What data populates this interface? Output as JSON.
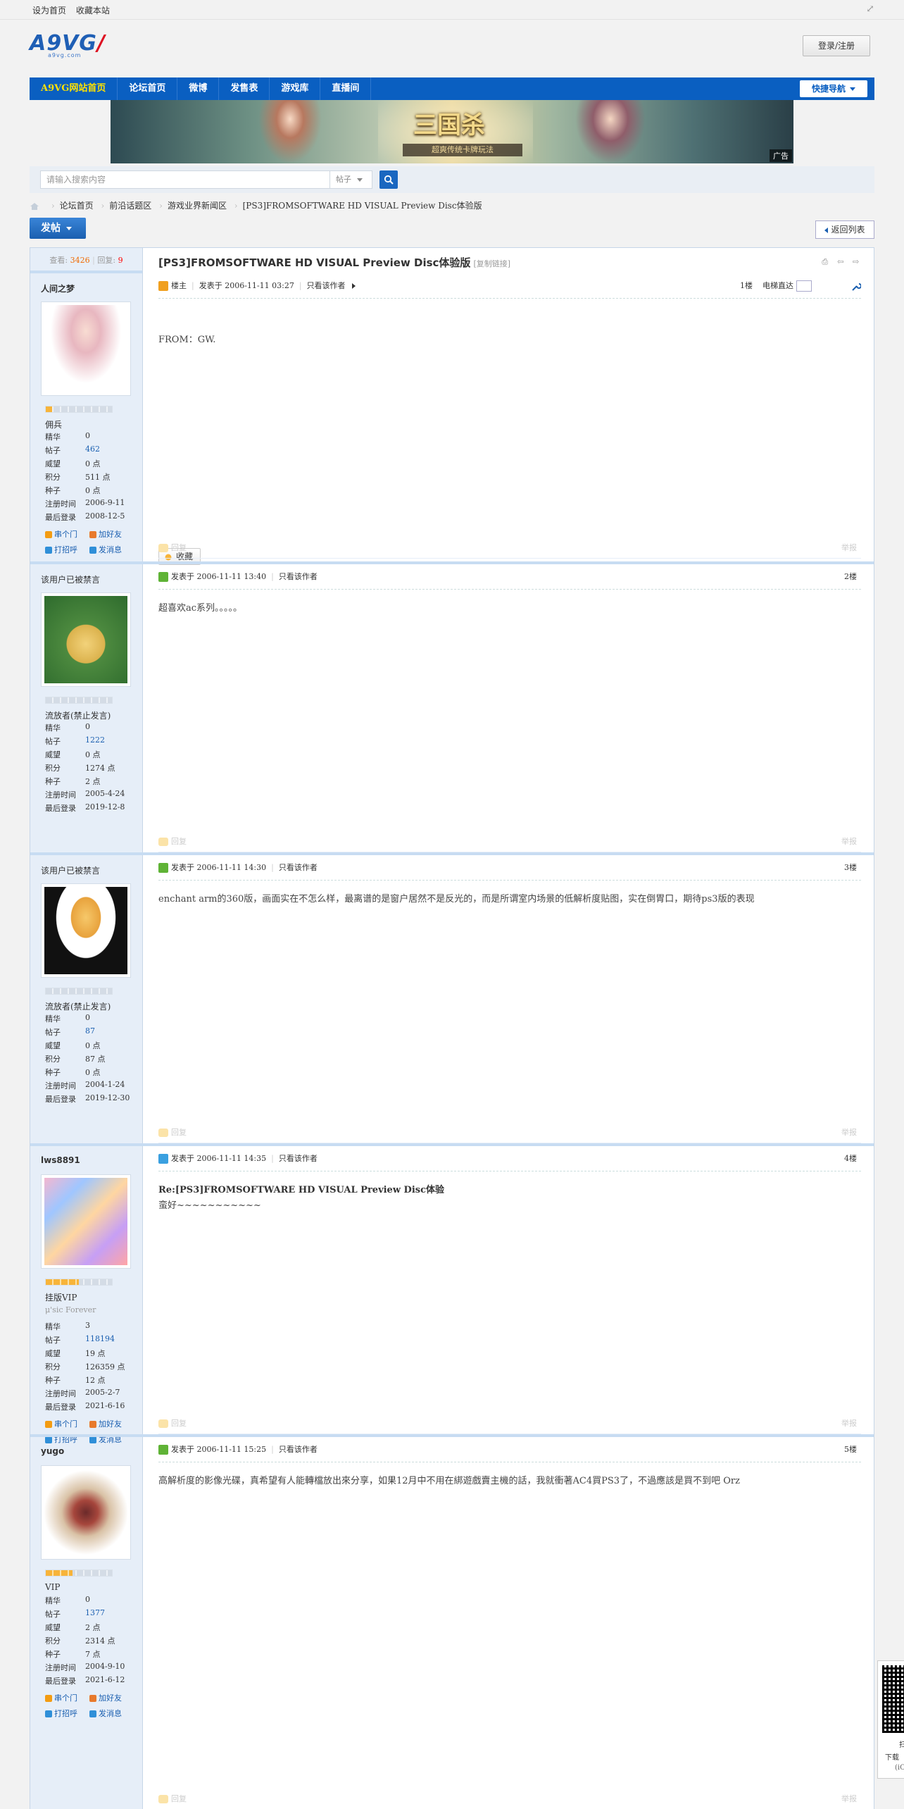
{
  "topbar": {
    "set_home": "设为首页",
    "bookmark": "收藏本站"
  },
  "header": {
    "logo_text": "A9VG",
    "logo_sub": "a9vg.com",
    "login_label": "登录/注册"
  },
  "nav": {
    "items": [
      "A9VG网站首页",
      "论坛首页",
      "微博",
      "发售表",
      "游戏库",
      "直播间"
    ],
    "quick": "快捷导航"
  },
  "banner": {
    "title": "三国杀",
    "subtitle": "超爽传统卡牌玩法",
    "ad_label": "广告"
  },
  "search": {
    "placeholder": "请输入搜索内容",
    "type": "帖子"
  },
  "breadcrumb": [
    "论坛首页",
    "前沿话题区",
    "游戏业界新闻区",
    "[PS3]FROMSOFTWARE HD VISUAL Preview Disc体验版"
  ],
  "buttons": {
    "post": "发帖",
    "back": "返回列表"
  },
  "thread": {
    "views_label": "查看:",
    "views": "3426",
    "replies_label": "回复:",
    "replies": "9",
    "title": "[PS3]FROMSOFTWARE HD VISUAL Preview Disc体验版",
    "copy_link": "[复制链接]"
  },
  "labels": {
    "owner": "楼主",
    "posted_at": "发表于",
    "only_author": "只看该作者",
    "elevator": "电梯直达",
    "reply": "回复",
    "report": "举报",
    "favorite": "收藏",
    "stat_keys": [
      "精华",
      "帖子",
      "威望",
      "积分",
      "种子",
      "注册时间",
      "最后登录"
    ],
    "actions": [
      "串个门",
      "加好友",
      "打招呼",
      "发消息"
    ]
  },
  "posts": [
    {
      "author": "人间之梦",
      "rank": "佣兵",
      "motto": "",
      "stars": 0.1,
      "stats": [
        "0",
        "462",
        "0 点",
        "511 点",
        "0 点",
        "2006-9-11",
        "2008-12-5"
      ],
      "time": "2006-11-11 03:27",
      "floor": "1楼",
      "body": "FROM：GW.",
      "quote_title": ""
    },
    {
      "author": "该用户已被禁言",
      "rank": "流放者(禁止发言)",
      "motto": "",
      "stars": 0,
      "stats": [
        "0",
        "1222",
        "0 点",
        "1274 点",
        "2 点",
        "2005-4-24",
        "2019-12-8"
      ],
      "time": "2006-11-11 13:40",
      "floor": "2楼",
      "body": "超喜欢ac系列。。。。。",
      "quote_title": ""
    },
    {
      "author": "该用户已被禁言",
      "rank": "流放者(禁止发言)",
      "motto": "",
      "stars": 0,
      "stats": [
        "0",
        "87",
        "0 点",
        "87 点",
        "0 点",
        "2004-1-24",
        "2019-12-30"
      ],
      "time": "2006-11-11 14:30",
      "floor": "3楼",
      "body": "enchant arm的360版，画面实在不怎么样，最离谱的是窗户居然不是反光的，而是所谓室内场景的低解析度贴图，实在倒胃口，期待ps3版的表现",
      "quote_title": ""
    },
    {
      "author": "lws8891",
      "rank": "挂版VIP",
      "motto": "μ'sic Forever",
      "stars": 0.5,
      "stats": [
        "3",
        "118194",
        "19 点",
        "126359 点",
        "12 点",
        "2005-2-7",
        "2021-6-16"
      ],
      "time": "2006-11-11 14:35",
      "floor": "4楼",
      "body": "蛮好~~~~~~~~~~~",
      "quote_title": "Re:[PS3]FROMSOFTWARE HD VISUAL Preview Disc体验"
    },
    {
      "author": "yugo",
      "rank": "VIP",
      "motto": "",
      "stars": 0.4,
      "stats": [
        "0",
        "1377",
        "2 点",
        "2314 点",
        "7 点",
        "2004-9-10",
        "2021-6-12"
      ],
      "time": "2006-11-11 15:25",
      "floor": "5楼",
      "body": "高解析度的影像光碟，真希望有人能轉檔放出來分享，如果12月中不用在綁遊戲賣主機的話，我就衝著AC4買PS3了，不過應該是買不到吧 Orz",
      "quote_title": ""
    }
  ],
  "qr": {
    "line1": "扫",
    "line2": "下载",
    "line3": "(iO"
  }
}
